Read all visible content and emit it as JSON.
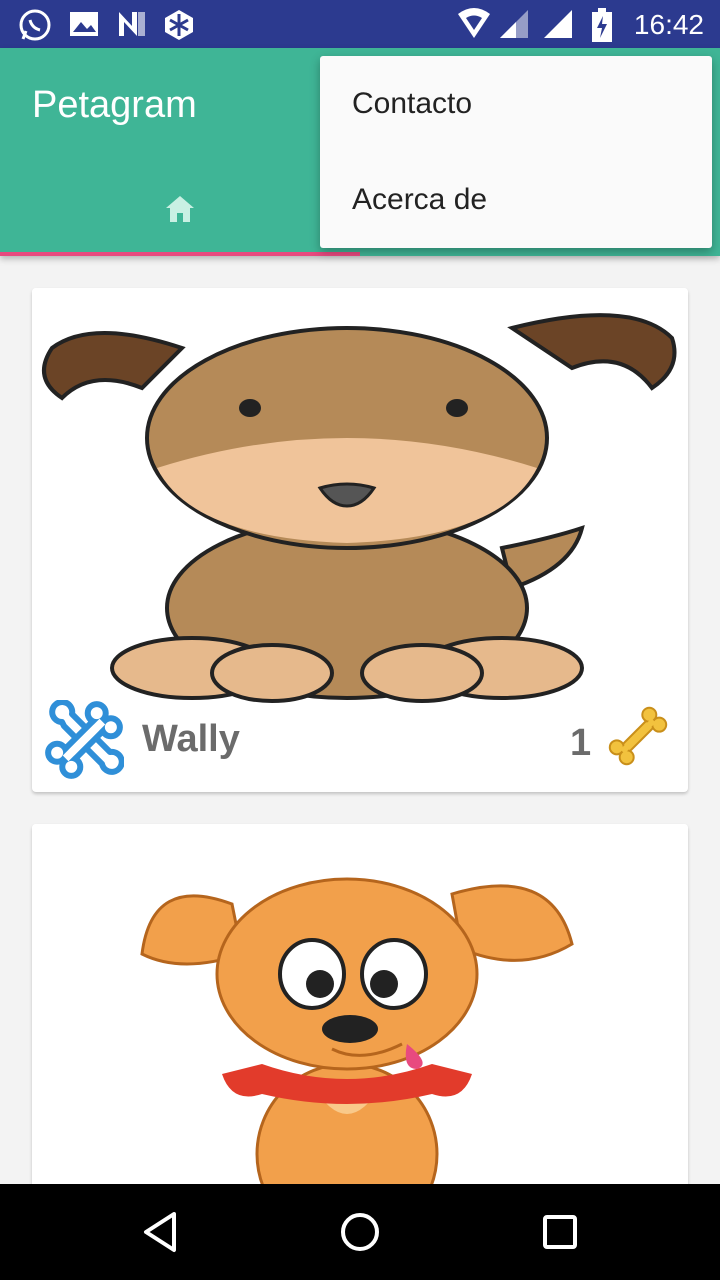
{
  "status_bar": {
    "time": "16:42",
    "left_icons": [
      "whatsapp-icon",
      "image-icon",
      "n-icon",
      "wall-icon"
    ],
    "right_icons": [
      "wifi-icon",
      "signal-icon",
      "signal-full-icon",
      "battery-icon"
    ]
  },
  "app_bar": {
    "title": "Petagram",
    "tabs": [
      {
        "icon": "home-icon",
        "selected": true
      }
    ],
    "accent": "#3fb596",
    "indicator_color": "#e84a7f"
  },
  "overflow_menu": {
    "items": [
      {
        "label": "Contacto"
      },
      {
        "label": "Acerca de"
      }
    ]
  },
  "pets": [
    {
      "name": "Wally",
      "likes": "1",
      "image": "brown-puppy-illustration"
    },
    {
      "name": "",
      "likes": "",
      "image": "orange-puppy-illustration"
    }
  ],
  "nav_bar": {
    "buttons": [
      "back-icon",
      "home-circle-icon",
      "recents-icon"
    ]
  }
}
